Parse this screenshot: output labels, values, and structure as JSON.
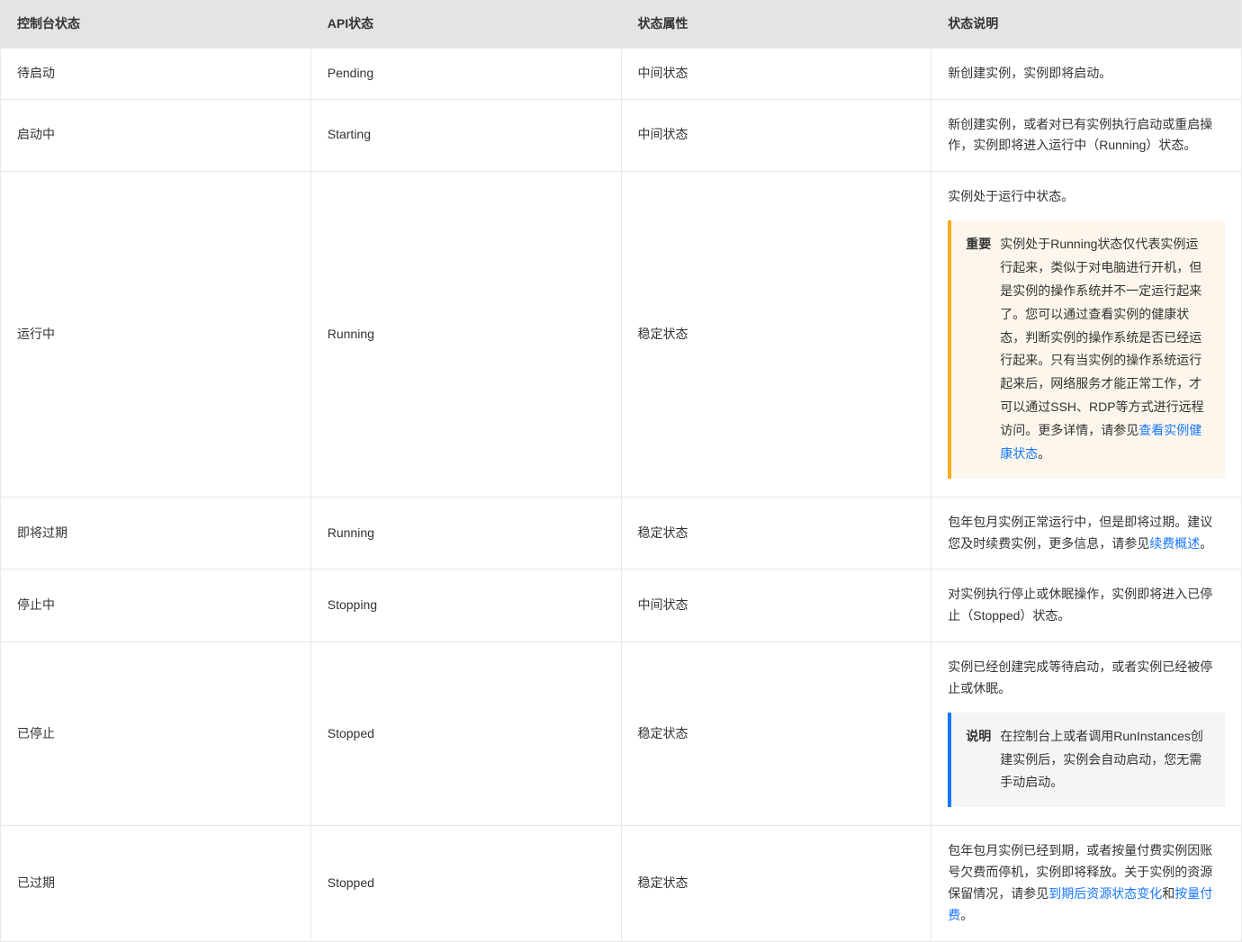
{
  "table": {
    "headers": {
      "console_status": "控制台状态",
      "api_status": "API状态",
      "status_attr": "状态属性",
      "status_desc": "状态说明"
    },
    "rows": [
      {
        "console": "待启动",
        "api": "Pending",
        "attr": "中间状态",
        "desc_text": "新创建实例，实例即将启动。"
      },
      {
        "console": "启动中",
        "api": "Starting",
        "attr": "中间状态",
        "desc_text": "新创建实例，或者对已有实例执行启动或重启操作，实例即将进入运行中（Running）状态。"
      },
      {
        "console": "运行中",
        "api": "Running",
        "attr": "稳定状态",
        "desc_text": "实例处于运行中状态。",
        "callout": {
          "type": "important",
          "label": "重要",
          "body_pre": "实例处于Running状态仅代表实例运行起来，类似于对电脑进行开机，但是实例的操作系统并不一定运行起来了。您可以通过查看实例的健康状态，判断实例的操作系统是否已经运行起来。只有当实例的操作系统运行起来后，网络服务才能正常工作，才可以通过SSH、RDP等方式进行远程访问。更多详情，请参见",
          "link1": "查看实例健康状态",
          "body_post": "。"
        }
      },
      {
        "console": "即将过期",
        "api": "Running",
        "attr": "稳定状态",
        "desc_pre": "包年包月实例正常运行中，但是即将过期。建议您及时续费实例，更多信息，请参见",
        "link1": "续费概述",
        "desc_post": "。"
      },
      {
        "console": "停止中",
        "api": "Stopping",
        "attr": "中间状态",
        "desc_text": "对实例执行停止或休眠操作，实例即将进入已停止（Stopped）状态。"
      },
      {
        "console": "已停止",
        "api": "Stopped",
        "attr": "稳定状态",
        "desc_text": "实例已经创建完成等待启动，或者实例已经被停止或休眠。",
        "callout": {
          "type": "note",
          "label": "说明",
          "body": "在控制台上或者调用RunInstances创建实例后，实例会自动启动，您无需手动启动。"
        }
      },
      {
        "console": "已过期",
        "api": "Stopped",
        "attr": "稳定状态",
        "desc_pre": "包年包月实例已经到期，或者按量付费实例因账号欠费而停机，实例即将释放。关于实例的资源保留情况，请参见",
        "link1": "到期后资源状态变化",
        "mid": "和",
        "link2": "按量付费",
        "desc_post": "。"
      }
    ]
  }
}
